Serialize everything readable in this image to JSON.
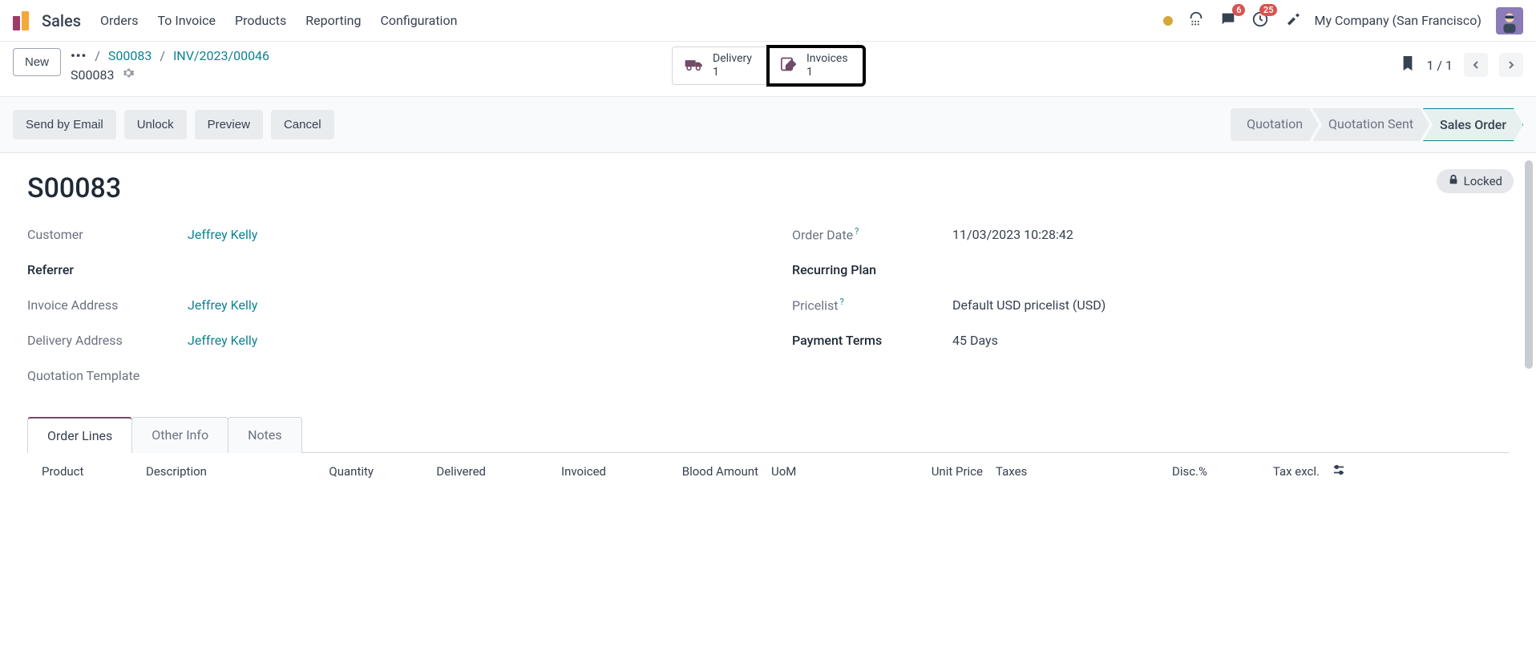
{
  "topbar": {
    "app": "Sales",
    "menu": [
      "Orders",
      "To Invoice",
      "Products",
      "Reporting",
      "Configuration"
    ],
    "chat_badge": "6",
    "clock_badge": "25",
    "company": "My Company (San Francisco)"
  },
  "subbar": {
    "new_label": "New",
    "crumb_dots": "•••",
    "crumb1": "S00083",
    "crumb2": "INV/2023/00046",
    "current": "S00083",
    "smart": [
      {
        "label": "Delivery",
        "count": "1"
      },
      {
        "label": "Invoices",
        "count": "1"
      }
    ],
    "pager": "1 / 1"
  },
  "actions": {
    "buttons": [
      "Send by Email",
      "Unlock",
      "Preview",
      "Cancel"
    ],
    "statuses": [
      "Quotation",
      "Quotation Sent",
      "Sales Order"
    ]
  },
  "form": {
    "locked": "Locked",
    "title": "S00083",
    "left": {
      "customer_label": "Customer",
      "customer": "Jeffrey Kelly",
      "referrer_label": "Referrer",
      "invoice_addr_label": "Invoice Address",
      "invoice_addr": "Jeffrey Kelly",
      "delivery_addr_label": "Delivery Address",
      "delivery_addr": "Jeffrey Kelly",
      "quote_tpl_label": "Quotation Template"
    },
    "right": {
      "order_date_label": "Order Date",
      "order_date": "11/03/2023 10:28:42",
      "recurring_label": "Recurring Plan",
      "pricelist_label": "Pricelist",
      "pricelist": "Default USD pricelist (USD)",
      "payment_terms_label": "Payment Terms",
      "payment_terms": "45 Days"
    }
  },
  "tabs": [
    "Order Lines",
    "Other Info",
    "Notes"
  ],
  "table": {
    "headers": {
      "product": "Product",
      "description": "Description",
      "quantity": "Quantity",
      "delivered": "Delivered",
      "invoiced": "Invoiced",
      "blood": "Blood Amount",
      "uom": "UoM",
      "unit_price": "Unit Price",
      "taxes": "Taxes",
      "disc": "Disc.%",
      "tax_excl": "Tax excl."
    }
  }
}
